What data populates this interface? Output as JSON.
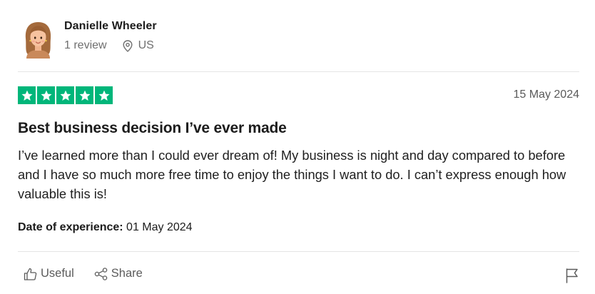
{
  "reviewer": {
    "name": "Danielle Wheeler",
    "review_count": "1 review",
    "location": "US",
    "avatar_icon": "avatar-illustration-woman"
  },
  "review": {
    "rating": 5,
    "rating_max": 5,
    "date": "15 May 2024",
    "title": "Best business decision I’ve ever made",
    "body": "I’ve learned more than I could ever dream of! My business is night and day compared to before and I have so much more free time to enjoy the things I want to do. I can’t express enough how valuable this is!",
    "experience_label": "Date of experience:",
    "experience_date": " 01 May 2024"
  },
  "actions": {
    "useful_label": "Useful",
    "share_label": "Share",
    "useful_icon": "thumbs-up-icon",
    "share_icon": "share-icon",
    "flag_icon": "flag-icon"
  },
  "colors": {
    "star_green": "#00b67a",
    "divider": "#e5e5e5",
    "muted_text": "#6f6f6f"
  }
}
